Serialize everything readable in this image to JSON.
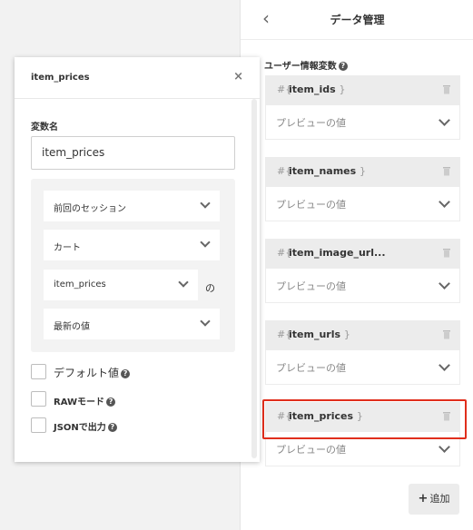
{
  "right_panel": {
    "title": "データ管理",
    "section_label": "ユーザー情報変数",
    "preview_text": "プレビューの値",
    "variables": [
      {
        "name": "item_ids",
        "suffix": "}"
      },
      {
        "name": "item_names",
        "suffix": "}"
      },
      {
        "name": "item_image_url...",
        "suffix": ""
      },
      {
        "name": "item_urls",
        "suffix": "}"
      },
      {
        "name": "item_prices",
        "suffix": "}"
      }
    ],
    "hash_prefix": "#{",
    "add_button": {
      "icon": "+",
      "label": "追加"
    }
  },
  "modal": {
    "title": "item_prices",
    "close": "×",
    "field_label": "変数名",
    "name_value": "item_prices",
    "source_selects": {
      "session": "前回のセッション",
      "cart": "カート",
      "key": "item_prices",
      "key_suffix": "の",
      "latest": "最新の値"
    },
    "options": [
      {
        "label": "デフォルト値",
        "checked": false
      },
      {
        "label": "RAWモード",
        "checked": false
      },
      {
        "label": "JSONで出力",
        "checked": false
      }
    ]
  },
  "colors": {
    "highlight": "#e02e1c",
    "card_header": "#ececec",
    "background": "#f2f2f2"
  }
}
